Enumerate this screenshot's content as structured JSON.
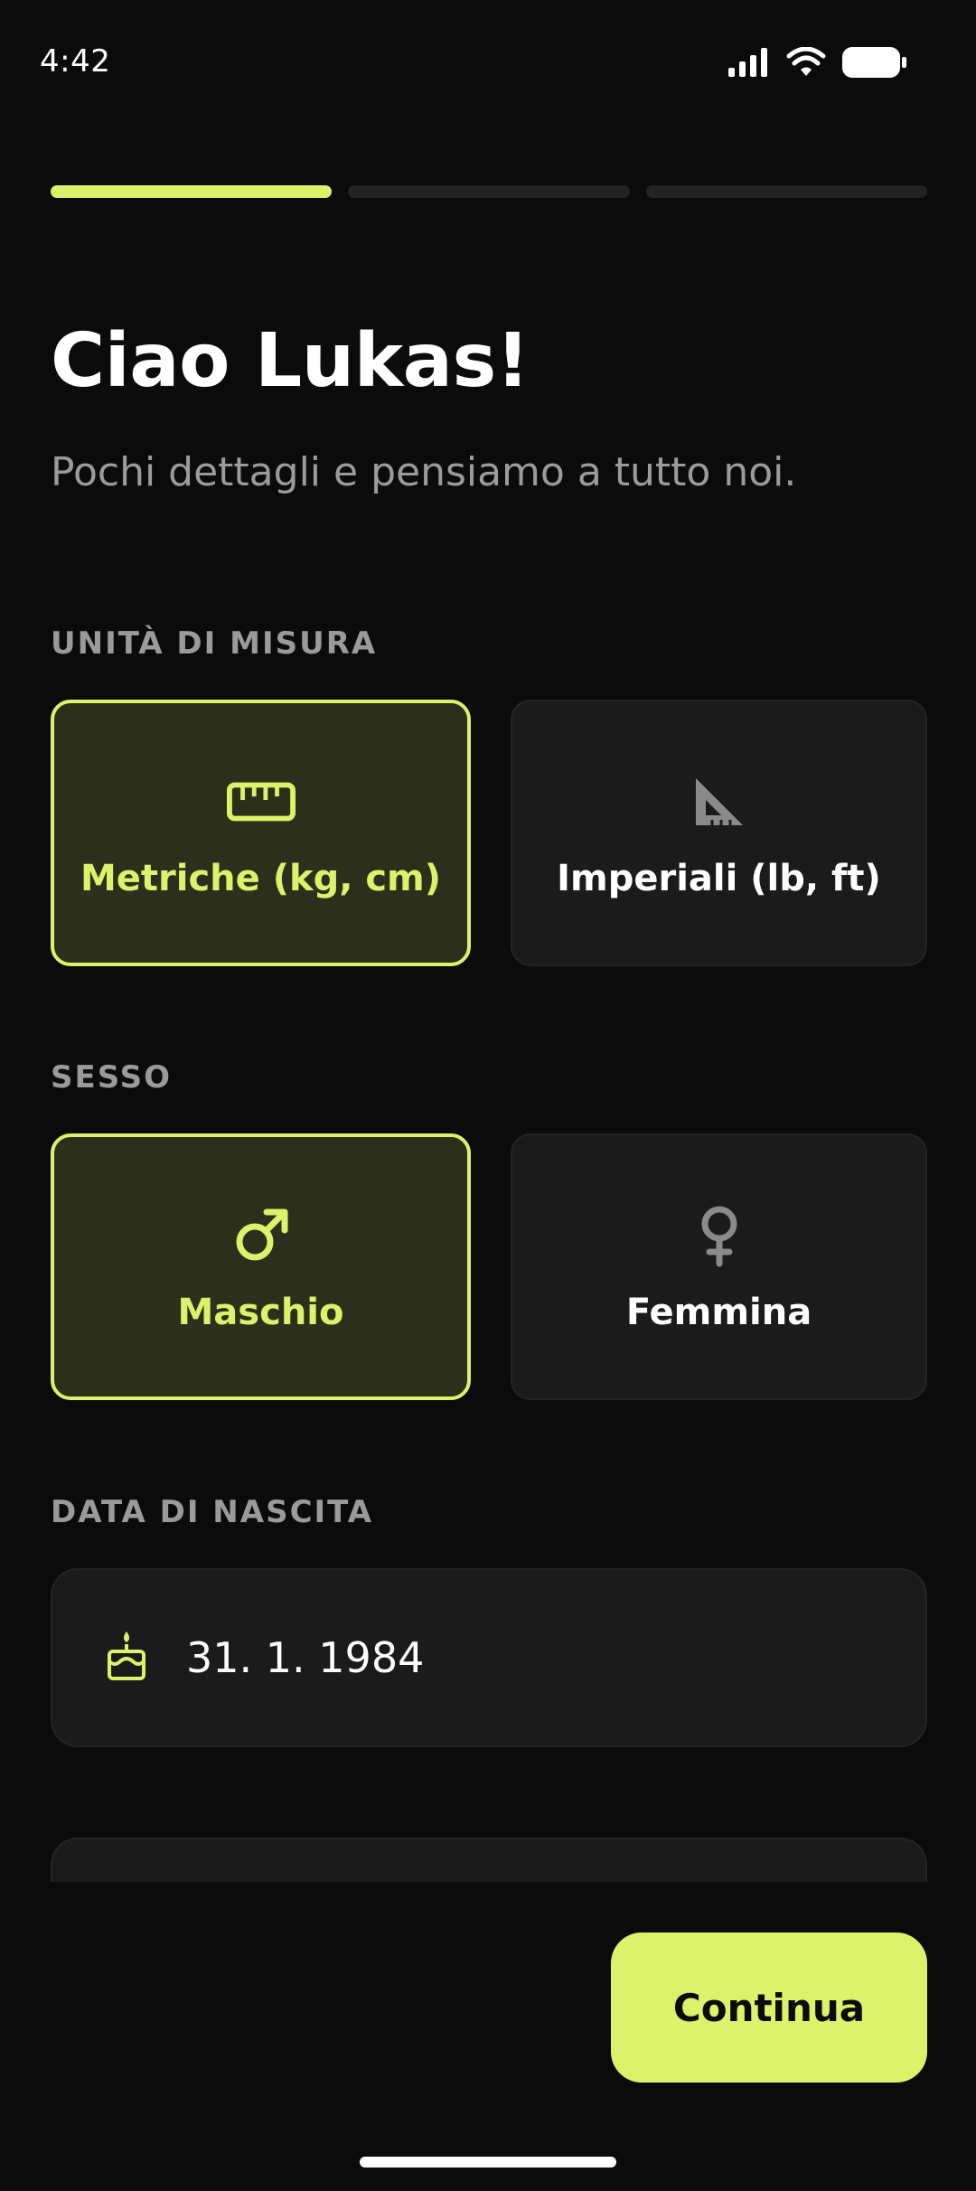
{
  "status_bar": {
    "time": "4:42",
    "icons": [
      "signal-icon",
      "wifi-icon",
      "battery-icon"
    ]
  },
  "progress": {
    "total_steps": 3,
    "current_step": 1
  },
  "header": {
    "title": "Ciao Lukas!",
    "subtitle": "Pochi dettagli e pensiamo a tutto noi."
  },
  "units": {
    "label": "UNITÀ DI MISURA",
    "options": [
      {
        "label": "Metriche (kg, cm)",
        "icon": "ruler-icon",
        "selected": true
      },
      {
        "label": "Imperiali (lb, ft)",
        "icon": "set-square-icon",
        "selected": false
      }
    ]
  },
  "sex": {
    "label": "SESSO",
    "options": [
      {
        "label": "Maschio",
        "icon": "male-symbol-icon",
        "selected": true
      },
      {
        "label": "Femmina",
        "icon": "female-symbol-icon",
        "selected": false
      }
    ]
  },
  "birth_date": {
    "label": "DATA DI NASCITA",
    "value": "31. 1. 1984",
    "icon": "cake-icon"
  },
  "actions": {
    "continue_label": "Continua"
  },
  "colors": {
    "accent": "#dcf26a",
    "background": "#0b0b0b",
    "card": "#1b1b1b",
    "selected_card": "#2c2f1b",
    "muted_text": "#9b9b9b"
  }
}
